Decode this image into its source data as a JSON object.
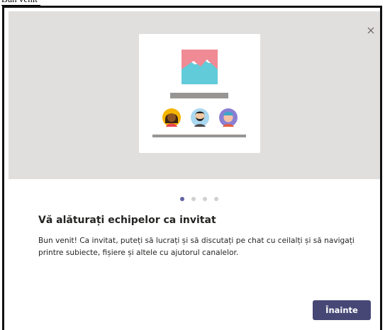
{
  "caption": {
    "text": "Bun venit"
  },
  "dialog": {
    "close_icon": "close-icon",
    "title": "Vă alăturați echipelor ca invitat",
    "body": "Bun venit! Ca invitat, puteți să lucrați și să discutați pe chat cu ceilalți și să navigați printre subiecte, fișiere și altele cu ajutorul canalelor.",
    "next_label": "Înainte"
  },
  "pagination": {
    "total": 4,
    "current": 1
  },
  "colors": {
    "hero_bg": "#e1dfdd",
    "accent": "#6264a7",
    "button_bg": "#464775",
    "dot_inactive": "#d2d0ce"
  }
}
